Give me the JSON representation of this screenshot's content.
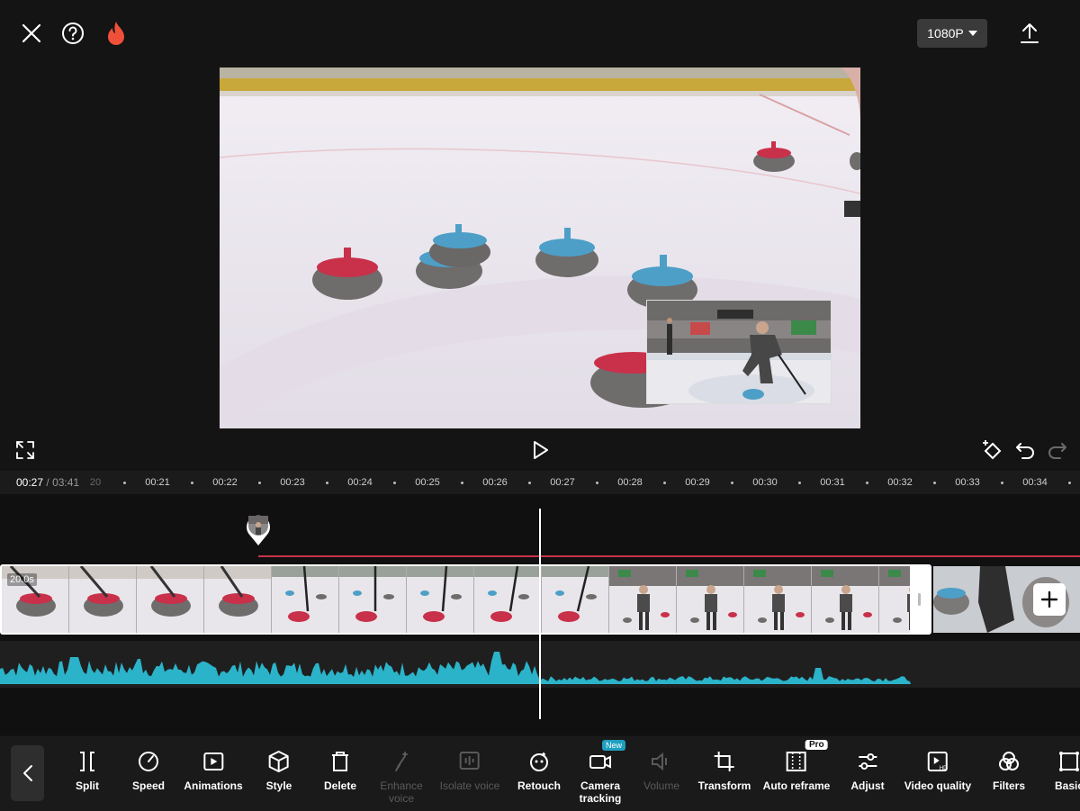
{
  "header": {
    "resolution_label": "1080P"
  },
  "ruler": {
    "current_time": "00:27",
    "separator": "/",
    "total_time": "03:41",
    "labels": [
      "20",
      "00:21",
      "00:22",
      "00:23",
      "00:24",
      "00:25",
      "00:26",
      "00:27",
      "00:28",
      "00:29",
      "00:30",
      "00:31",
      "00:32",
      "00:33",
      "00:34"
    ]
  },
  "timeline": {
    "clip_duration": "20.0s"
  },
  "toolbar": {
    "tools": [
      {
        "id": "split",
        "label": "Split",
        "icon": "split-icon",
        "enabled": true
      },
      {
        "id": "speed",
        "label": "Speed",
        "icon": "speed-icon",
        "enabled": true
      },
      {
        "id": "animations",
        "label": "Animations",
        "icon": "animations-icon",
        "enabled": true
      },
      {
        "id": "style",
        "label": "Style",
        "icon": "style-cube-icon",
        "enabled": true
      },
      {
        "id": "delete",
        "label": "Delete",
        "icon": "trash-icon",
        "enabled": true
      },
      {
        "id": "enhance-voice",
        "label": "Enhance voice",
        "icon": "enhance-voice-icon",
        "enabled": false
      },
      {
        "id": "isolate-voice",
        "label": "Isolate voice",
        "icon": "isolate-voice-icon",
        "enabled": false
      },
      {
        "id": "retouch",
        "label": "Retouch",
        "icon": "retouch-icon",
        "enabled": true
      },
      {
        "id": "camera-tracking",
        "label": "Camera tracking",
        "icon": "camera-icon",
        "enabled": true,
        "badge": "New"
      },
      {
        "id": "volume",
        "label": "Volume",
        "icon": "volume-icon",
        "enabled": false
      },
      {
        "id": "transform",
        "label": "Transform",
        "icon": "crop-icon",
        "enabled": true
      },
      {
        "id": "auto-reframe",
        "label": "Auto reframe",
        "icon": "reframe-icon",
        "enabled": true,
        "badge": "Pro"
      },
      {
        "id": "adjust",
        "label": "Adjust",
        "icon": "sliders-icon",
        "enabled": true
      },
      {
        "id": "video-quality",
        "label": "Video quality",
        "icon": "hd-icon",
        "enabled": true
      },
      {
        "id": "filters",
        "label": "Filters",
        "icon": "filters-icon",
        "enabled": true
      },
      {
        "id": "basic",
        "label": "Basic",
        "icon": "basic-icon",
        "enabled": true
      }
    ]
  },
  "colors": {
    "background": "#141414",
    "accent_audio": "#2bb3c9",
    "overlay_line": "#c8344a",
    "new_badge": "#1e9fbf"
  }
}
